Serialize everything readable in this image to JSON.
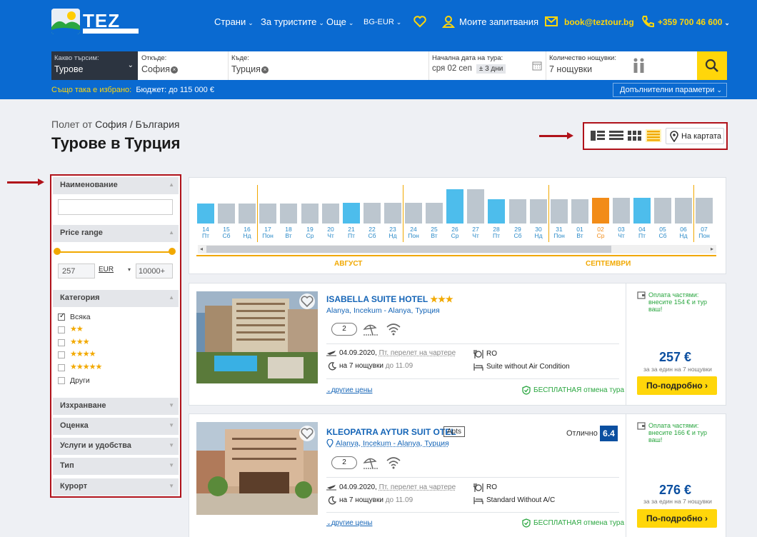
{
  "colors": {
    "brand_blue": "#0a6ad1",
    "accent_yellow": "#ffd60a",
    "highlight_red": "#b0121a",
    "selected_orange": "#f28c18",
    "cal_blue": "#4dbdec",
    "cal_grey": "#bcc6cf"
  },
  "header": {
    "logo_text": "TEZ",
    "nav": {
      "countries": "Страни",
      "for_tourists": "За туристите",
      "more": "Още",
      "currency": "BG-EUR",
      "my_requests": "Моите запитвания",
      "email": "book@teztour.bg",
      "phone": "+359 700 46 600"
    },
    "icons": {
      "favorites": "heart-icon",
      "user": "user-icon",
      "mail": "mail-icon",
      "phone": "phone-icon"
    }
  },
  "search": {
    "what_label": "Какво търсим:",
    "what_value": "Турове",
    "from_label": "Откъде:",
    "from_value": "София",
    "to_label": "Къде:",
    "to_value": "Турция",
    "date_label": "Начална дата на тура:",
    "date_value": "сря 02 сеп",
    "days_flex": "± 3 дни",
    "nights_label": "Количество нощувки:",
    "nights_value": "7 нощувки",
    "also_selected": "Също така е избрано:",
    "budget": "Бюджет: до 115 000 €",
    "extra_params": "Допълнителни параметри"
  },
  "page": {
    "crumb_prefix": "Полет от",
    "crumb_city": "София / България",
    "title": "Турове в Турция",
    "map_label": "На картата"
  },
  "sidebar": {
    "name_head": "Наименование",
    "price_head": "Price range",
    "price_min": "257",
    "currency": "EUR",
    "price_max": "10000+",
    "category_head": "Категория",
    "category_all": "Всяка",
    "category_other": "Други",
    "category_stars": [
      "★★",
      "★★★",
      "★★★★",
      "★★★★★"
    ],
    "sections": [
      "Изхранване",
      "Оценка",
      "Услуги и удобства",
      "Тип",
      "Курорт"
    ]
  },
  "calendar": {
    "days": [
      {
        "d": "14",
        "w": "Пт",
        "v": 0.5,
        "c": "b"
      },
      {
        "d": "15",
        "w": "Сб",
        "v": 0.5,
        "c": "g"
      },
      {
        "d": "16",
        "w": "Нд",
        "v": 0.5,
        "c": "g"
      },
      {
        "d": "17",
        "w": "Пон",
        "v": 0.5,
        "c": "g"
      },
      {
        "d": "18",
        "w": "Вт",
        "v": 0.5,
        "c": "g"
      },
      {
        "d": "19",
        "w": "Ср",
        "v": 0.5,
        "c": "g"
      },
      {
        "d": "20",
        "w": "Чт",
        "v": 0.5,
        "c": "g"
      },
      {
        "d": "21",
        "w": "Пт",
        "v": 0.52,
        "c": "b"
      },
      {
        "d": "22",
        "w": "Сб",
        "v": 0.52,
        "c": "g"
      },
      {
        "d": "23",
        "w": "Нд",
        "v": 0.52,
        "c": "g"
      },
      {
        "d": "24",
        "w": "Пон",
        "v": 0.52,
        "c": "g"
      },
      {
        "d": "25",
        "w": "Вт",
        "v": 0.52,
        "c": "g"
      },
      {
        "d": "26",
        "w": "Ср",
        "v": 0.85,
        "c": "b"
      },
      {
        "d": "27",
        "w": "Чт",
        "v": 0.85,
        "c": "g"
      },
      {
        "d": "28",
        "w": "Пт",
        "v": 0.61,
        "c": "b"
      },
      {
        "d": "29",
        "w": "Сб",
        "v": 0.61,
        "c": "g"
      },
      {
        "d": "30",
        "w": "Нд",
        "v": 0.61,
        "c": "g"
      },
      {
        "d": "31",
        "w": "Пон",
        "v": 0.61,
        "c": "g"
      },
      {
        "d": "01",
        "w": "Вт",
        "v": 0.61,
        "c": "g"
      },
      {
        "d": "02",
        "w": "Ср",
        "v": 0.65,
        "c": "o"
      },
      {
        "d": "03",
        "w": "Чт",
        "v": 0.65,
        "c": "g"
      },
      {
        "d": "04",
        "w": "Пт",
        "v": 0.65,
        "c": "b"
      },
      {
        "d": "05",
        "w": "Сб",
        "v": 0.65,
        "c": "g"
      },
      {
        "d": "06",
        "w": "Нд",
        "v": 0.65,
        "c": "g"
      },
      {
        "d": "07",
        "w": "Пон",
        "v": 0.65,
        "c": "g"
      }
    ],
    "month1": "АВГУСТ",
    "month2": "СЕПТЕМВРИ"
  },
  "hotels": [
    {
      "name": "ISABELLA SUITE HOTEL",
      "stars": "★★★",
      "location": "Alanya, Incekum - Alanya, Турция",
      "guests": "2",
      "date": "04.09.2020,",
      "flight": "Пт. перелет на чартере",
      "nights": "на 7 нощувки",
      "until": "до 11.09",
      "meal": "RO",
      "room": "Suite without Air Condition",
      "other_prices": "другие цены",
      "free_cancel": "БЕСПЛАТНАЯ отмена тура",
      "installment": [
        "Оплата частями:",
        "внесите 154 € и тур",
        "ваш!"
      ],
      "price": "257 €",
      "per_person": "за за един на 7 нощувки",
      "cta": "По-подробно ›"
    },
    {
      "name": "KLEOPATRA AYTUR SUIT OTEL",
      "type_badge": "Apts",
      "rating_label": "Отлично",
      "rating": "6.4",
      "location": "Alanya, Incekum - Alanya, Турция",
      "guests": "2",
      "date": "04.09.2020,",
      "flight": "Пт. перелет на чартере",
      "nights": "на 7 нощувки",
      "until": "до 11.09",
      "meal": "RO",
      "room": "Standard Without A/C",
      "other_prices": "другие цены",
      "free_cancel": "БЕСПЛАТНАЯ отмена тура",
      "installment": [
        "Оплата частями:",
        "внесите 166 € и тур",
        "ваш!"
      ],
      "price": "276 €",
      "per_person": "за за един на 7 нощувки",
      "cta": "По-подробно ›"
    }
  ]
}
